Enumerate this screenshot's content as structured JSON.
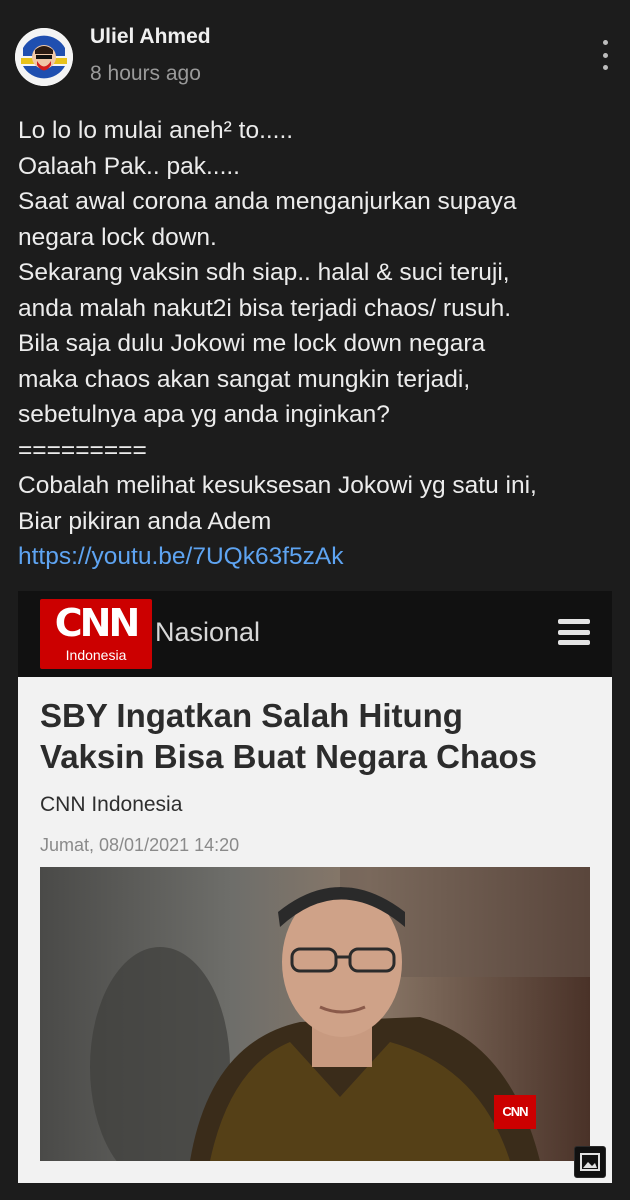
{
  "post": {
    "author": "Uliel Ahmed",
    "time": "8 hours ago",
    "lines": [
      "Lo lo lo mulai aneh² to.....",
      "Oalaah Pak.. pak.....",
      "Saat awal corona anda menganjurkan supaya",
      "negara lock down.",
      "Sekarang vaksin sdh siap.. halal & suci teruji,",
      "anda malah nakut2i bisa terjadi chaos/ rusuh.",
      "Bila saja dulu Jokowi me lock down negara",
      "maka chaos akan sangat mungkin terjadi,",
      "sebetulnya apa yg anda inginkan?",
      "=========",
      "Cobalah melihat kesuksesan Jokowi yg satu ini,",
      "Biar pikiran anda Adem"
    ],
    "link": "https://youtu.be/7UQk63f5zAk"
  },
  "embed": {
    "logo_big": "CNN",
    "logo_small": "Indonesia",
    "section": "Nasional",
    "headline_line1": "SBY Ingatkan Salah Hitung",
    "headline_line2": "Vaksin Bisa Buat Negara Chaos",
    "source": "CNN Indonesia",
    "date": "Jumat, 08/01/2021 14:20",
    "photo_logo": "CNN"
  },
  "icons": {
    "more": "more-vertical-icon",
    "image": "image-icon"
  }
}
